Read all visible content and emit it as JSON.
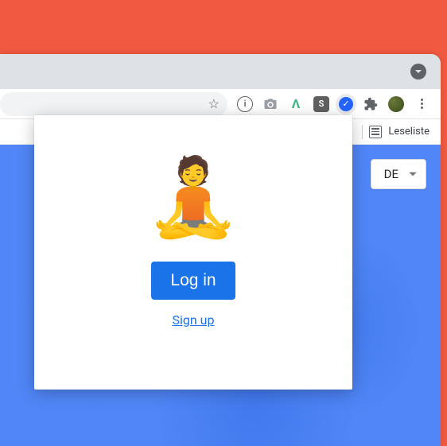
{
  "toolbar": {
    "star_icon": "bookmark-star-icon",
    "extensions": {
      "info": "i",
      "camera": "camera-icon",
      "vue": "V",
      "s": "S",
      "check": "✓",
      "puzzle": "extensions-icon",
      "avatar": "profile-avatar",
      "menu": "browser-menu-icon"
    }
  },
  "bookmarks": {
    "reading_list_label": "Leseliste"
  },
  "page": {
    "lang_selector": {
      "value": "DE"
    }
  },
  "popup": {
    "emoji": "🧘",
    "login_label": "Log in",
    "signup_label": "Sign up"
  }
}
